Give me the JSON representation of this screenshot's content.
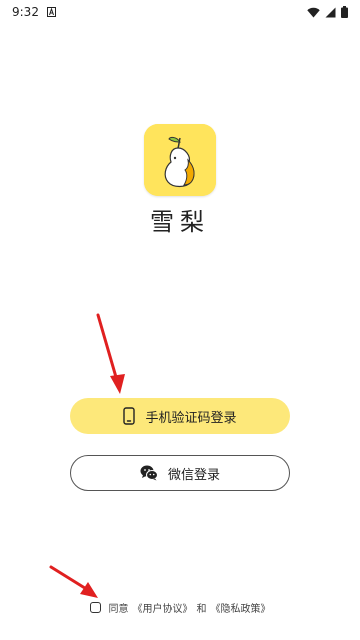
{
  "status_bar": {
    "time": "9:32",
    "notification_icon": "a-letter-icon",
    "wifi_icon": "wifi-icon",
    "signal_icon": "signal-icon",
    "battery_icon": "battery-icon"
  },
  "app": {
    "name": "雪梨",
    "logo": "pear-logo-icon",
    "logo_bg": "#ffe45c"
  },
  "login": {
    "phone_label": "手机验证码登录",
    "phone_icon": "phone-icon",
    "wechat_label": "微信登录",
    "wechat_icon": "wechat-icon"
  },
  "agreement": {
    "agree_text": "同意",
    "user_agreement": "《用户协议》",
    "and_text": "和",
    "privacy_policy": "《隐私政策》",
    "checked": false
  },
  "colors": {
    "accent_yellow": "#fde87a",
    "arrow_red": "#e02020"
  }
}
